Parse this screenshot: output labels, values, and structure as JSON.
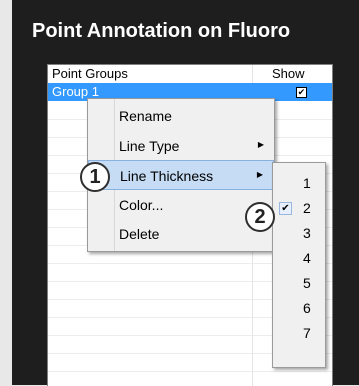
{
  "panel": {
    "title": "Point Annotation on Fluoro"
  },
  "table": {
    "columns": [
      "Point Groups",
      "Show"
    ],
    "selected_row": {
      "name": "Group 1",
      "show_checked": true
    }
  },
  "context_menu": {
    "items": [
      {
        "label": "Rename",
        "has_submenu": false
      },
      {
        "label": "Line Type",
        "has_submenu": true
      },
      {
        "label": "Line Thickness",
        "has_submenu": true,
        "highlighted": true
      },
      {
        "label": "Color...",
        "has_submenu": false
      },
      {
        "label": "Delete",
        "has_submenu": false
      }
    ]
  },
  "thickness_submenu": {
    "options": [
      "1",
      "2",
      "3",
      "4",
      "5",
      "6",
      "7"
    ],
    "selected": "2"
  },
  "callouts": [
    "1",
    "2"
  ],
  "icons": {
    "submenu_arrow": "triangle-right-icon",
    "checkmark": "checkmark-icon"
  },
  "colors": {
    "selection": "#3399ff",
    "panel_bg": "#1e1e1e",
    "menu_highlight": "#c6dcf5"
  }
}
